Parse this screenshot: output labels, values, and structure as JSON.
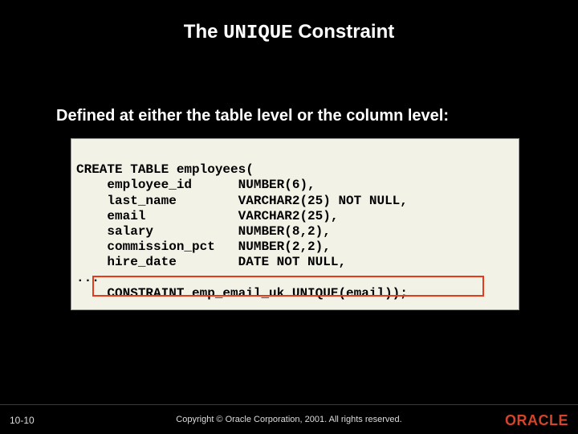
{
  "title": {
    "pre": "The ",
    "mono": "UNIQUE",
    "post": " Constraint"
  },
  "subtitle": "Defined at either the table level or the column level:",
  "code": {
    "l1": "CREATE TABLE employees(",
    "l2": "    employee_id      NUMBER(6),",
    "l3": "    last_name        VARCHAR2(25) NOT NULL,",
    "l4": "    email            VARCHAR2(25),",
    "l5": "    salary           NUMBER(8,2),",
    "l6": "    commission_pct   NUMBER(2,2),",
    "l7": "    hire_date        DATE NOT NULL,",
    "l8": "...",
    "l9": "    CONSTRAINT emp_email_uk UNIQUE(email));"
  },
  "footer": {
    "page": "10-10",
    "copyright": "Copyright © Oracle Corporation, 2001. All rights reserved.",
    "logo": "ORACLE"
  }
}
